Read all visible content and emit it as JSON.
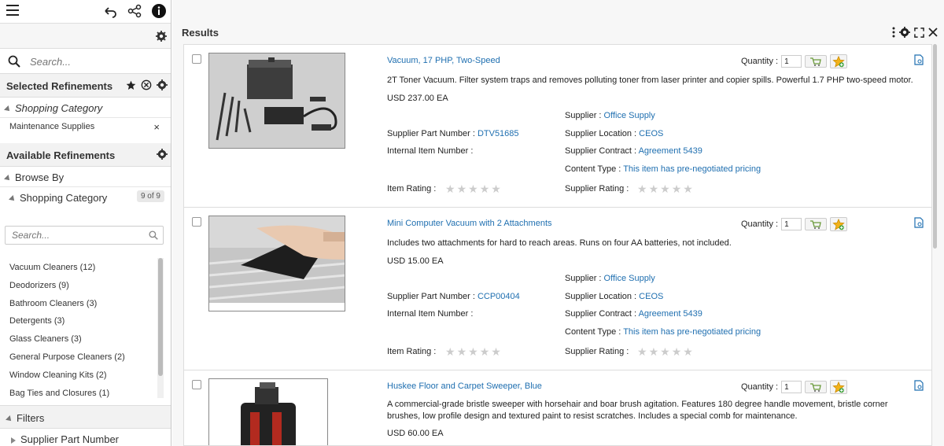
{
  "toolbar": {
    "menu": "menu",
    "undo": "undo",
    "share": "share",
    "info": "info"
  },
  "search": {
    "placeholder": "Search..."
  },
  "selected_refinements": {
    "title": "Selected Refinements",
    "category_label": "Shopping Category",
    "chip": "Maintenance Supplies",
    "chip_remove": "×"
  },
  "available_refinements": {
    "title": "Available Refinements",
    "browse_by": "Browse By",
    "category_label": "Shopping Category",
    "category_count": "9 of 9",
    "facet_search_placeholder": "Search...",
    "items": [
      "Vacuum Cleaners (12)",
      "Deodorizers (9)",
      "Bathroom Cleaners (3)",
      "Detergents (3)",
      "Glass Cleaners (3)",
      "General Purpose Cleaners (2)",
      "Window Cleaning Kits (2)",
      "Bag Ties and Closures (1)"
    ]
  },
  "filters": {
    "title": "Filters",
    "supplier_part_number": "Supplier Part Number"
  },
  "results": {
    "title": "Results",
    "labels": {
      "quantity": "Quantity :",
      "supplier": "Supplier : ",
      "supplier_part_number": "Supplier Part Number : ",
      "supplier_location": "Supplier Location : ",
      "internal_item_number": "Internal Item Number :",
      "supplier_contract": "Supplier Contract : ",
      "content_type": "Content Type : ",
      "item_rating": "Item Rating :",
      "supplier_rating": "Supplier Rating :"
    },
    "items": [
      {
        "title": "Vacuum, 17 PHP, Two-Speed",
        "description": "2T Toner Vacuum. Filter system traps and removes polluting toner from laser printer and copier spills. Powerful 1.7 PHP two-speed motor.",
        "price": "USD 237.00 EA",
        "quantity": "1",
        "supplier": "Office Supply",
        "supplier_part_number": "DTV51685",
        "supplier_location": "CEOS",
        "supplier_contract": "Agreement 5439",
        "content_type": "This item has pre-negotiated pricing"
      },
      {
        "title": "Mini Computer Vacuum with 2 Attachments",
        "description": "Includes two attachments for hard to reach areas. Runs on four AA batteries, not included.",
        "price": "USD 15.00 EA",
        "quantity": "1",
        "supplier": "Office Supply",
        "supplier_part_number": "CCP00404",
        "supplier_location": "CEOS",
        "supplier_contract": "Agreement 5439",
        "content_type": "This item has pre-negotiated pricing"
      },
      {
        "title": "Huskee Floor and Carpet Sweeper, Blue",
        "description": "A commercial-grade bristle sweeper with horsehair and boar brush agitation. Features 180 degree handle movement, bristle corner brushes, low profile design and textured paint to resist scratches. Includes a special comb for maintenance.",
        "price": "USD 60.00 EA",
        "quantity": "1"
      }
    ]
  },
  "colors": {
    "link": "#1f6fb0",
    "panel_header": "#f2f2f2",
    "star_off": "#cccccc"
  }
}
